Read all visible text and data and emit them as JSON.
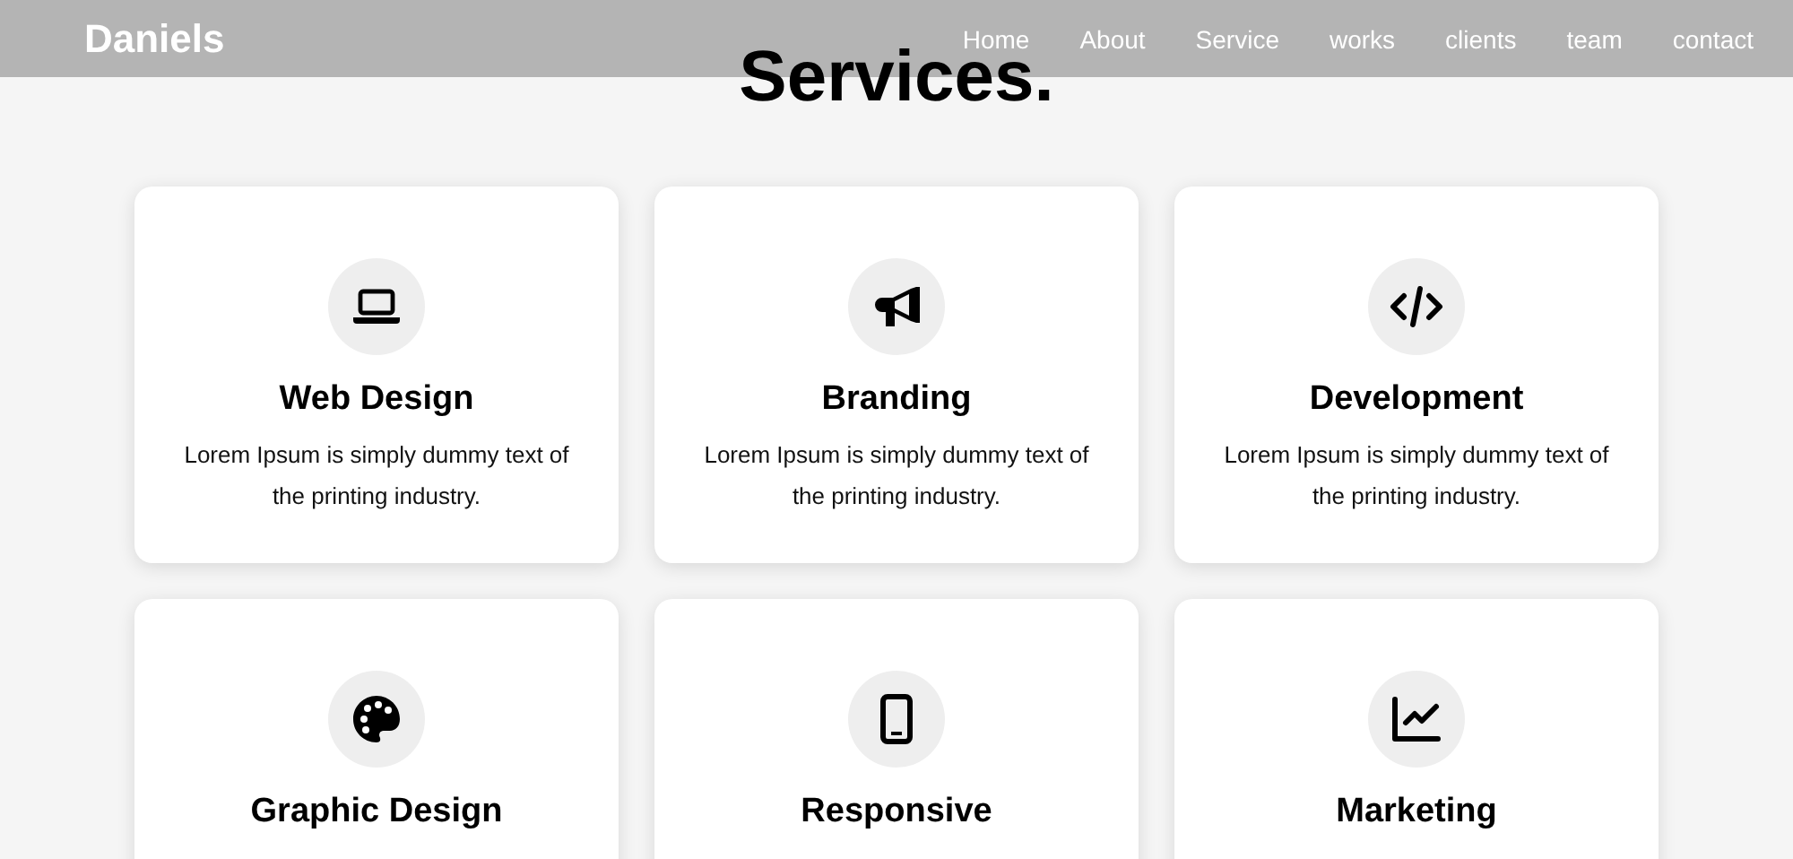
{
  "header": {
    "logo": "Daniels",
    "nav": [
      {
        "label": "Home"
      },
      {
        "label": "About"
      },
      {
        "label": "Service"
      },
      {
        "label": "works"
      },
      {
        "label": "clients"
      },
      {
        "label": "team"
      },
      {
        "label": "contact"
      }
    ]
  },
  "title": "Services.",
  "services": [
    {
      "title": "Web Design",
      "description": "Lorem Ipsum is simply dummy text of the printing industry."
    },
    {
      "title": "Branding",
      "description": "Lorem Ipsum is simply dummy text of the printing industry."
    },
    {
      "title": "Development",
      "description": "Lorem Ipsum is simply dummy text of the printing industry."
    },
    {
      "title": "Graphic Design"
    },
    {
      "title": "Responsive"
    },
    {
      "title": "Marketing"
    }
  ]
}
